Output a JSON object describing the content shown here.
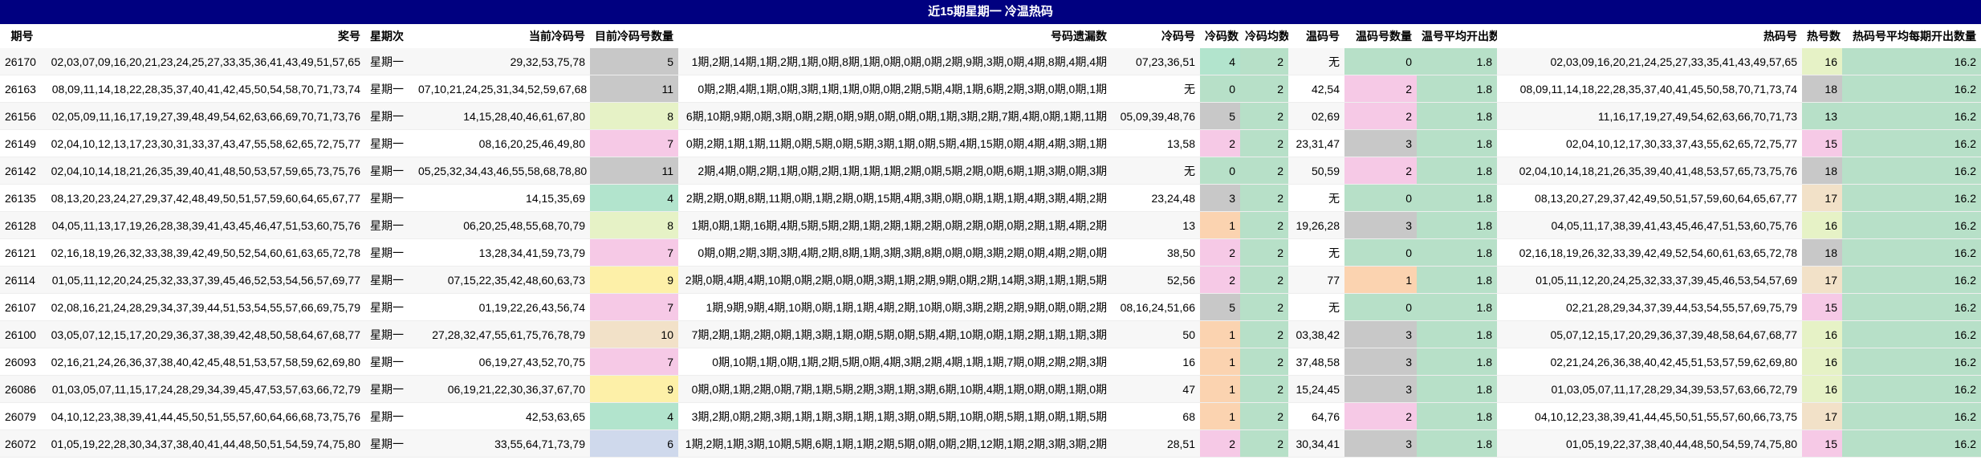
{
  "title": "近15期星期一 冷温热码",
  "headers": [
    "期号",
    "奖号",
    "星期次",
    "当前冷码号",
    "目前冷码号数量",
    "号码遗漏数",
    "冷码号",
    "冷码数",
    "冷码均数",
    "温码号",
    "温码号数量",
    "温号平均开出数",
    "热码号",
    "热号数",
    "热码号平均每期开出数量"
  ],
  "colors": {
    "title_bg": "#000080",
    "green": "#b7e0c8",
    "count": {
      "0": "#b7e0c8",
      "1": "#fbd3b0",
      "2": "#f6c9e6",
      "3": "#c8c8c8",
      "4": "#b2e4cd",
      "5": "#c8c8c8",
      "6": "#cfd9ec",
      "7": "#f6c9e6",
      "8": "#e6f2c6",
      "9": "#fdf0a8",
      "10": "#f2e1c8",
      "11": "#c8c8c8",
      "13": "#b7e0c8",
      "15": "#f6c9e6",
      "16": "#e6f2c6",
      "17": "#f2e1c8",
      "18": "#c8c8c8"
    }
  },
  "rows": [
    {
      "qh": "26170",
      "jh": "02,03,07,09,16,20,21,23,24,25,27,33,35,36,41,43,49,51,57,65",
      "xq": "星期一",
      "lmh": "29,32,53,75,78",
      "lmsl": "5",
      "yl": "1期,2期,14期,1期,2期,1期,0期,8期,1期,0期,0期,0期,2期,9期,3期,0期,4期,8期,4期,4期",
      "lm": "07,23,36,51",
      "lms": "4",
      "lmjs": "2",
      "wmh": "无",
      "wmsl": "0",
      "wpj": "1.8",
      "rmh": "02,03,09,16,20,21,24,25,27,33,35,41,43,49,57,65",
      "rms": "16",
      "rpj": "16.2"
    },
    {
      "qh": "26163",
      "jh": "08,09,11,14,18,22,28,35,37,40,41,42,45,50,54,58,70,71,73,74",
      "xq": "星期一",
      "lmh": "07,10,21,24,25,31,34,52,59,67,68",
      "lmsl": "11",
      "yl": "0期,2期,4期,1期,0期,3期,1期,1期,0期,0期,2期,5期,4期,1期,6期,2期,3期,0期,0期,1期",
      "lm": "无",
      "lms": "0",
      "lmjs": "2",
      "wmh": "42,54",
      "wmsl": "2",
      "wpj": "1.8",
      "rmh": "08,09,11,14,18,22,28,35,37,40,41,45,50,58,70,71,73,74",
      "rms": "18",
      "rpj": "16.2"
    },
    {
      "qh": "26156",
      "jh": "02,05,09,11,16,17,19,27,39,48,49,54,62,63,66,69,70,71,73,76",
      "xq": "星期一",
      "lmh": "14,15,28,40,46,61,67,80",
      "lmsl": "8",
      "yl": "6期,10期,9期,0期,3期,0期,2期,0期,9期,0期,0期,0期,1期,3期,2期,7期,4期,0期,1期,11期",
      "lm": "05,09,39,48,76",
      "lms": "5",
      "lmjs": "2",
      "wmh": "02,69",
      "wmsl": "2",
      "wpj": "1.8",
      "rmh": "11,16,17,19,27,49,54,62,63,66,70,71,73",
      "rms": "13",
      "rpj": "16.2"
    },
    {
      "qh": "26149",
      "jh": "02,04,10,12,13,17,23,30,31,33,37,43,47,55,58,62,65,72,75,77",
      "xq": "星期一",
      "lmh": "08,16,20,25,46,49,80",
      "lmsl": "7",
      "yl": "0期,2期,1期,1期,11期,0期,5期,0期,5期,3期,1期,0期,5期,4期,15期,0期,4期,4期,3期,1期",
      "lm": "13,58",
      "lms": "2",
      "lmjs": "2",
      "wmh": "23,31,47",
      "wmsl": "3",
      "wpj": "1.8",
      "rmh": "02,04,10,12,17,30,33,37,43,55,62,65,72,75,77",
      "rms": "15",
      "rpj": "16.2"
    },
    {
      "qh": "26142",
      "jh": "02,04,10,14,18,21,26,35,39,40,41,48,50,53,57,59,65,73,75,76",
      "xq": "星期一",
      "lmh": "05,25,32,34,43,46,55,58,68,78,80",
      "lmsl": "11",
      "yl": "2期,4期,0期,2期,1期,0期,2期,1期,1期,1期,2期,0期,5期,2期,0期,6期,1期,3期,0期,3期",
      "lm": "无",
      "lms": "0",
      "lmjs": "2",
      "wmh": "50,59",
      "wmsl": "2",
      "wpj": "1.8",
      "rmh": "02,04,10,14,18,21,26,35,39,40,41,48,53,57,65,73,75,76",
      "rms": "18",
      "rpj": "16.2"
    },
    {
      "qh": "26135",
      "jh": "08,13,20,23,24,27,29,37,42,48,49,50,51,57,59,60,64,65,67,77",
      "xq": "星期一",
      "lmh": "14,15,35,69",
      "lmsl": "4",
      "yl": "2期,2期,0期,8期,11期,0期,1期,2期,0期,15期,4期,3期,0期,0期,1期,1期,4期,3期,4期,2期",
      "lm": "23,24,48",
      "lms": "3",
      "lmjs": "2",
      "wmh": "无",
      "wmsl": "0",
      "wpj": "1.8",
      "rmh": "08,13,20,27,29,37,42,49,50,51,57,59,60,64,65,67,77",
      "rms": "17",
      "rpj": "16.2"
    },
    {
      "qh": "26128",
      "jh": "04,05,11,13,17,19,26,28,38,39,41,43,45,46,47,51,53,60,75,76",
      "xq": "星期一",
      "lmh": "06,20,25,48,55,68,70,79",
      "lmsl": "8",
      "yl": "1期,0期,1期,16期,4期,5期,5期,2期,1期,2期,1期,2期,0期,2期,0期,0期,2期,1期,4期,2期",
      "lm": "13",
      "lms": "1",
      "lmjs": "2",
      "wmh": "19,26,28",
      "wmsl": "3",
      "wpj": "1.8",
      "rmh": "04,05,11,17,38,39,41,43,45,46,47,51,53,60,75,76",
      "rms": "16",
      "rpj": "16.2"
    },
    {
      "qh": "26121",
      "jh": "02,16,18,19,26,32,33,38,39,42,49,50,52,54,60,61,63,65,72,78",
      "xq": "星期一",
      "lmh": "13,28,34,41,59,73,79",
      "lmsl": "7",
      "yl": "0期,0期,2期,3期,3期,4期,2期,8期,1期,3期,3期,8期,0期,0期,3期,2期,0期,4期,2期,0期",
      "lm": "38,50",
      "lms": "2",
      "lmjs": "2",
      "wmh": "无",
      "wmsl": "0",
      "wpj": "1.8",
      "rmh": "02,16,18,19,26,32,33,39,42,49,52,54,60,61,63,65,72,78",
      "rms": "18",
      "rpj": "16.2"
    },
    {
      "qh": "26114",
      "jh": "01,05,11,12,20,24,25,32,33,37,39,45,46,52,53,54,56,57,69,77",
      "xq": "星期一",
      "lmh": "07,15,22,35,42,48,60,63,73",
      "lmsl": "9",
      "yl": "2期,0期,4期,4期,10期,0期,2期,0期,0期,3期,1期,2期,9期,0期,2期,14期,3期,1期,1期,5期",
      "lm": "52,56",
      "lms": "2",
      "lmjs": "2",
      "wmh": "77",
      "wmsl": "1",
      "wpj": "1.8",
      "rmh": "01,05,11,12,20,24,25,32,33,37,39,45,46,53,54,57,69",
      "rms": "17",
      "rpj": "16.2"
    },
    {
      "qh": "26107",
      "jh": "02,08,16,21,24,28,29,34,37,39,44,51,53,54,55,57,66,69,75,79",
      "xq": "星期一",
      "lmh": "01,19,22,26,43,56,74",
      "lmsl": "7",
      "yl": "1期,9期,9期,4期,10期,0期,1期,1期,4期,2期,10期,0期,3期,2期,2期,9期,0期,0期,2期",
      "lm": "08,16,24,51,66",
      "lms": "5",
      "lmjs": "2",
      "wmh": "无",
      "wmsl": "0",
      "wpj": "1.8",
      "rmh": "02,21,28,29,34,37,39,44,53,54,55,57,69,75,79",
      "rms": "15",
      "rpj": "16.2"
    },
    {
      "qh": "26100",
      "jh": "03,05,07,12,15,17,20,29,36,37,38,39,42,48,50,58,64,67,68,77",
      "xq": "星期一",
      "lmh": "27,28,32,47,55,61,75,76,78,79",
      "lmsl": "10",
      "yl": "7期,2期,1期,2期,0期,1期,3期,1期,0期,5期,0期,5期,4期,10期,0期,1期,2期,1期,1期,3期",
      "lm": "50",
      "lms": "1",
      "lmjs": "2",
      "wmh": "03,38,42",
      "wmsl": "3",
      "wpj": "1.8",
      "rmh": "05,07,12,15,17,20,29,36,37,39,48,58,64,67,68,77",
      "rms": "16",
      "rpj": "16.2"
    },
    {
      "qh": "26093",
      "jh": "02,16,21,24,26,36,37,38,40,42,45,48,51,53,57,58,59,62,69,80",
      "xq": "星期一",
      "lmh": "06,19,27,43,52,70,75",
      "lmsl": "7",
      "yl": "0期,10期,1期,0期,1期,2期,5期,0期,4期,3期,2期,4期,1期,1期,7期,0期,2期,2期,3期",
      "lm": "16",
      "lms": "1",
      "lmjs": "2",
      "wmh": "37,48,58",
      "wmsl": "3",
      "wpj": "1.8",
      "rmh": "02,21,24,26,36,38,40,42,45,51,53,57,59,62,69,80",
      "rms": "16",
      "rpj": "16.2"
    },
    {
      "qh": "26086",
      "jh": "01,03,05,07,11,15,17,24,28,29,34,39,45,47,53,57,63,66,72,79",
      "xq": "星期一",
      "lmh": "06,19,21,22,30,36,37,67,70",
      "lmsl": "9",
      "yl": "0期,0期,1期,2期,0期,7期,1期,5期,2期,3期,1期,3期,6期,10期,4期,1期,0期,0期,1期,0期",
      "lm": "47",
      "lms": "1",
      "lmjs": "2",
      "wmh": "15,24,45",
      "wmsl": "3",
      "wpj": "1.8",
      "rmh": "01,03,05,07,11,17,28,29,34,39,53,57,63,66,72,79",
      "rms": "16",
      "rpj": "16.2"
    },
    {
      "qh": "26079",
      "jh": "04,10,12,23,38,39,41,44,45,50,51,55,57,60,64,66,68,73,75,76",
      "xq": "星期一",
      "lmh": "42,53,63,65",
      "lmsl": "4",
      "yl": "3期,2期,0期,2期,3期,1期,1期,3期,1期,1期,3期,0期,5期,10期,0期,5期,1期,0期,1期,5期",
      "lm": "68",
      "lms": "1",
      "lmjs": "2",
      "wmh": "64,76",
      "wmsl": "2",
      "wpj": "1.8",
      "rmh": "04,10,12,23,38,39,41,44,45,50,51,55,57,60,66,73,75",
      "rms": "17",
      "rpj": "16.2"
    },
    {
      "qh": "26072",
      "jh": "01,05,19,22,28,30,34,37,38,40,41,44,48,50,51,54,59,74,75,80",
      "xq": "星期一",
      "lmh": "33,55,64,71,73,79",
      "lmsl": "6",
      "yl": "1期,2期,1期,3期,10期,5期,6期,1期,1期,2期,5期,0期,0期,2期,12期,1期,2期,3期,3期,2期",
      "lm": "28,51",
      "lms": "2",
      "lmjs": "2",
      "wmh": "30,34,41",
      "wmsl": "3",
      "wpj": "1.8",
      "rmh": "01,05,19,22,37,38,40,44,48,50,54,59,74,75,80",
      "rms": "15",
      "rpj": "16.2"
    }
  ]
}
